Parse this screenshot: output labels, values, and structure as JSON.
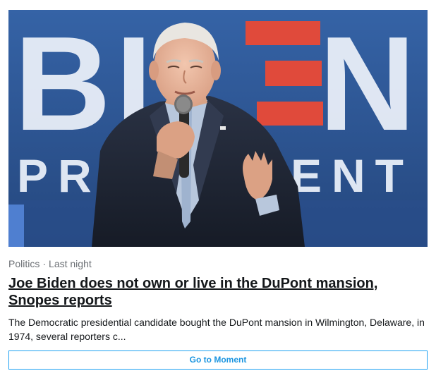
{
  "moment_card": {
    "image_alt": "Joe Biden speaking into a microphone in front of a BIDEN PRESIDENT banner",
    "image_banner_text": "BIDEN PRESIDENT",
    "category": "Politics",
    "separator": "·",
    "timestamp": "Last night",
    "headline": "Joe Biden does not own or live in the DuPont mansion, Snopes reports",
    "summary": "The Democratic presidential candidate bought the DuPont mansion in Wilmington, Delaware, in 1974, several reporters c...",
    "button_label": "Go to Moment"
  },
  "colors": {
    "banner_blue": "#2e5797",
    "banner_red": "#e04a3b",
    "link_blue": "#1da1f2",
    "text_dark": "#14171a",
    "text_muted": "#6b6f74"
  }
}
